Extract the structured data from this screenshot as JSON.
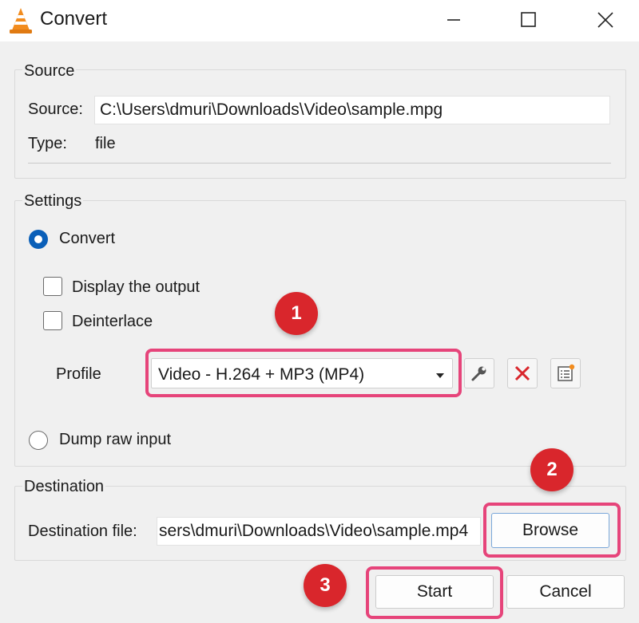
{
  "window": {
    "title": "Convert",
    "minimize_icon": "minimize-icon",
    "maximize_icon": "maximize-icon",
    "close_icon": "close-icon"
  },
  "source": {
    "group_title": "Source",
    "source_label": "Source:",
    "source_value": "C:\\Users\\dmuri\\Downloads\\Video\\sample.mpg",
    "type_label": "Type:",
    "type_value": "file"
  },
  "settings": {
    "group_title": "Settings",
    "convert_label": "Convert",
    "convert_selected": true,
    "display_output_label": "Display the output",
    "display_output_checked": false,
    "deinterlace_label": "Deinterlace",
    "deinterlace_checked": false,
    "profile_label": "Profile",
    "profile_value": "Video - H.264 + MP3 (MP4)",
    "dump_raw_label": "Dump raw input",
    "dump_raw_selected": false
  },
  "destination": {
    "group_title": "Destination",
    "file_label": "Destination file:",
    "file_value": "sers\\dmuri\\Downloads\\Video\\sample.mp4",
    "browse_label": "Browse"
  },
  "actions": {
    "start_label": "Start",
    "cancel_label": "Cancel"
  },
  "annotations": {
    "step1": "1",
    "step2": "2",
    "step3": "3",
    "highlight_color": "#e6447a",
    "badge_color": "#d9262c"
  },
  "colors": {
    "accent": "#0a5fb8",
    "delete_red": "#d9262c"
  }
}
